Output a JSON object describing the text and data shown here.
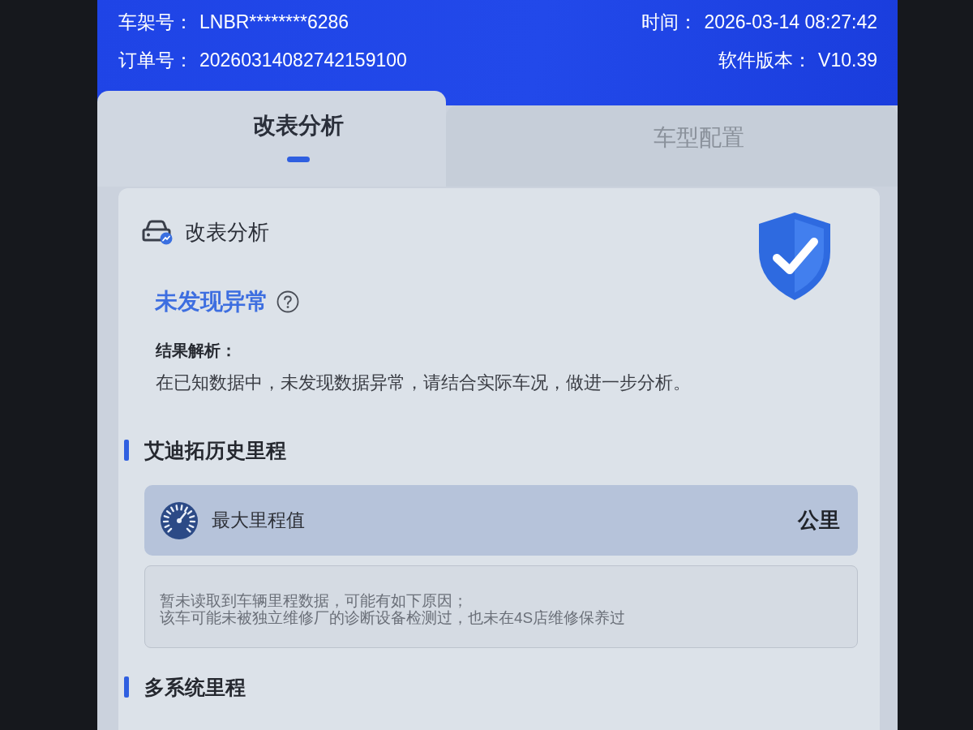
{
  "header": {
    "fields": [
      {
        "label": "车架号：",
        "value": "LNBR********6286"
      },
      {
        "label": "时间：",
        "value": "2026-03-14 08:27:42"
      },
      {
        "label": "订单号：",
        "value": "20260314082742159100"
      },
      {
        "label": "软件版本：",
        "value": "V10.39"
      }
    ]
  },
  "tabs": [
    {
      "label": "改表分析",
      "selected": true
    },
    {
      "label": "车型配置",
      "selected": false
    }
  ],
  "analysis": {
    "title": "改表分析",
    "status": "未发现异常",
    "result_label": "结果解析：",
    "result_text": "在已知数据中，未发现数据异常，请结合实际车况，做进一步分析。"
  },
  "sections": [
    {
      "title": "艾迪拓历史里程",
      "rows": [
        {
          "label": "最大里程值",
          "value": "公里"
        }
      ],
      "note_lines": [
        "暂未读取到车辆里程数据，可能有如下原因；",
        "该车可能未被独立维修厂的诊断设备检测过，也未在4S店维修保养过"
      ]
    },
    {
      "title": "多系统里程"
    }
  ]
}
